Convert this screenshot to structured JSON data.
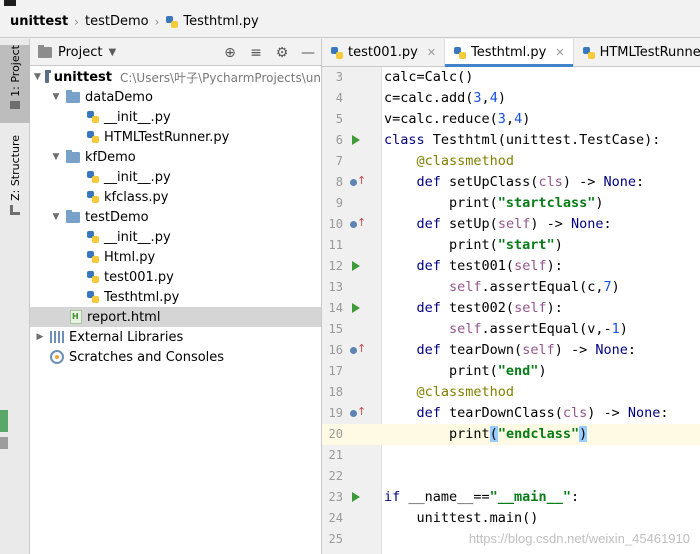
{
  "breadcrumb": {
    "project": "unittest",
    "folder": "testDemo",
    "file": "Testhtml.py"
  },
  "tool_windows": {
    "project_tab": "1: Project",
    "structure_tab": "Z: Structure"
  },
  "project_panel": {
    "title": "Project",
    "root": {
      "name": "unittest",
      "path": "C:\\Users\\叶子\\PycharmProjects\\un"
    },
    "tree": [
      {
        "label": "dataDemo",
        "kind": "folder",
        "depth": 1,
        "expanded": true
      },
      {
        "label": "__init__.py",
        "kind": "py",
        "depth": 2
      },
      {
        "label": "HTMLTestRunner.py",
        "kind": "py",
        "depth": 2
      },
      {
        "label": "kfDemo",
        "kind": "folder",
        "depth": 1,
        "expanded": true
      },
      {
        "label": "__init__.py",
        "kind": "py",
        "depth": 2
      },
      {
        "label": "kfclass.py",
        "kind": "py",
        "depth": 2
      },
      {
        "label": "testDemo",
        "kind": "folder",
        "depth": 1,
        "expanded": true
      },
      {
        "label": "__init__.py",
        "kind": "py",
        "depth": 2
      },
      {
        "label": "Html.py",
        "kind": "py",
        "depth": 2
      },
      {
        "label": "test001.py",
        "kind": "py",
        "depth": 2
      },
      {
        "label": "Testhtml.py",
        "kind": "py",
        "depth": 2
      },
      {
        "label": "report.html",
        "kind": "html",
        "depth": 1,
        "selected": true
      }
    ],
    "external_libraries": "External Libraries",
    "scratches": "Scratches and Consoles"
  },
  "editor": {
    "tabs": [
      {
        "label": "test001.py",
        "active": false
      },
      {
        "label": "Testhtml.py",
        "active": true
      },
      {
        "label": "HTMLTestRunner.py",
        "active": false
      }
    ],
    "lines": [
      {
        "n": "3",
        "text": "calc=Calc()"
      },
      {
        "n": "4",
        "text": "c=calc.add(3,4)"
      },
      {
        "n": "5",
        "text": "v=calc.reduce(3,4)"
      },
      {
        "n": "6",
        "text": "class Testhtml(unittest.TestCase):",
        "marker": "run"
      },
      {
        "n": "7",
        "text": "    @classmethod"
      },
      {
        "n": "8",
        "text": "    def setUpClass(cls) -> None:",
        "marker": "override"
      },
      {
        "n": "9",
        "text": "        print(\"startclass\")"
      },
      {
        "n": "10",
        "text": "    def setUp(self) -> None:",
        "marker": "override"
      },
      {
        "n": "11",
        "text": "        print(\"start\")"
      },
      {
        "n": "12",
        "text": "    def test001(self):",
        "marker": "run"
      },
      {
        "n": "13",
        "text": "        self.assertEqual(c,7)"
      },
      {
        "n": "14",
        "text": "    def test002(self):",
        "marker": "run"
      },
      {
        "n": "15",
        "text": "        self.assertEqual(v,-1)"
      },
      {
        "n": "16",
        "text": "    def tearDown(self) -> None:",
        "marker": "override"
      },
      {
        "n": "17",
        "text": "        print(\"end\")"
      },
      {
        "n": "18",
        "text": "    @classmethod"
      },
      {
        "n": "19",
        "text": "    def tearDownClass(cls) -> None:",
        "marker": "override"
      },
      {
        "n": "20",
        "text": "        print(\"endclass\")",
        "current": true
      },
      {
        "n": "21",
        "text": ""
      },
      {
        "n": "22",
        "text": ""
      },
      {
        "n": "23",
        "text": "if __name__==\"__main__\":",
        "marker": "run"
      },
      {
        "n": "24",
        "text": "    unittest.main()"
      },
      {
        "n": "25",
        "text": ""
      }
    ]
  },
  "watermark": "https://blog.csdn.net/weixin_45461910",
  "colors": {
    "keyword": "#000080",
    "decorator": "#808000",
    "self": "#94558d",
    "number": "#1750eb",
    "string": "#067d17",
    "tab_accent": "#4083c9",
    "current_line": "#fffae3",
    "selection": "#d5d5d5"
  }
}
